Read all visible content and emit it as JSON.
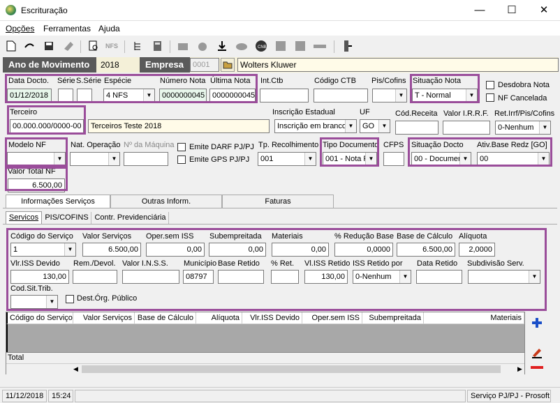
{
  "window": {
    "title": "Escrituração",
    "min": "—",
    "max": "☐",
    "close": "✕"
  },
  "menu": [
    "Opções",
    "Ferramentas",
    "Ajuda"
  ],
  "header": {
    "ano_label": "Ano de Movimento",
    "ano_value": "2018",
    "empresa_label": "Empresa",
    "empresa_code": "0001",
    "empresa_name": "Wolters Kluwer"
  },
  "fields": {
    "data_docto": {
      "label": "Data Docto.",
      "value": "01/12/2018"
    },
    "serie": {
      "label": "Série",
      "value": ""
    },
    "sserie": {
      "label": "S.Série",
      "value": ""
    },
    "especie": {
      "label": "Espécie",
      "value": "4 NFS"
    },
    "numero_nota": {
      "label": "Número Nota",
      "value": "0000000045"
    },
    "ultima_nota": {
      "label": "Última Nota",
      "value": "0000000045"
    },
    "int_ctb": {
      "label": "Int.Ctb",
      "value": ""
    },
    "codigo_ctb": {
      "label": "Código CTB",
      "value": ""
    },
    "pis_cofins": {
      "label": "Pis/Cofins",
      "value": ""
    },
    "situacao_nota": {
      "label": "Situação Nota",
      "value": "T - Normal"
    },
    "desdobra_nota": {
      "label": "Desdobra Nota"
    },
    "nf_cancelada": {
      "label": "NF Cancelada"
    },
    "terceiro": {
      "label": "Terceiro",
      "code": "00.000.000/0000-00",
      "name": "Terceiros Teste 2018"
    },
    "inscricao_estadual": {
      "label": "Inscrição Estadual",
      "value": "Inscrição em branco"
    },
    "uf": {
      "label": "UF",
      "value": "GO"
    },
    "cod_receita": {
      "label": "Cód.Receita",
      "value": ""
    },
    "valor_irrf": {
      "label": "Valor I.R.R.F.",
      "value": ""
    },
    "ret_irrf": {
      "label": "Ret.Irrf/Pis/Cofins",
      "value": "0-Nenhum"
    },
    "modelo_nf": {
      "label": "Modelo NF",
      "value": ""
    },
    "nat_operacao": {
      "label": "Nat. Operação",
      "value": ""
    },
    "num_maquina": {
      "label": "Nº da Máquina",
      "value": ""
    },
    "emite_darf": {
      "label": "Emite DARF PJ/PJ"
    },
    "emite_gps": {
      "label": "Emite GPS PJ/PJ"
    },
    "tp_recolhimento": {
      "label": "Tp. Recolhimento",
      "value": "001"
    },
    "tipo_documento": {
      "label": "Tipo Documento",
      "value": "001 - Nota F"
    },
    "cfps": {
      "label": "CFPS",
      "value": ""
    },
    "situacao_docto": {
      "label": "Situação Docto",
      "value": "00 - Documen"
    },
    "ativ_base": {
      "label": "Ativ.Base Redz [GO]",
      "value": "00"
    },
    "valor_total_nf": {
      "label": "Valor Total NF",
      "value": "6.500,00"
    }
  },
  "tabs_main": [
    "Informações Serviços",
    "Outras Inform.",
    "Faturas"
  ],
  "tabs_sub": [
    "Servicos",
    "PIS/COFINS",
    "Contr. Previdenciária"
  ],
  "servicos": {
    "codigo_servico": {
      "label": "Código do Serviço",
      "value": "1"
    },
    "valor_servicos": {
      "label": "Valor Serviços",
      "value": "6.500,00"
    },
    "oper_sem_iss": {
      "label": "Oper.sem ISS",
      "value": "0,00"
    },
    "subempreitada": {
      "label": "Subempreitada",
      "value": "0,00"
    },
    "materiais": {
      "label": "Materiais",
      "value": "0,00"
    },
    "reducao_base": {
      "label": "% Redução Base",
      "value": "0,0000"
    },
    "base_calculo": {
      "label": "Base de Cálculo",
      "value": "6.500,00"
    },
    "aliquota": {
      "label": "Alíquota",
      "value": "2,0000"
    },
    "vlr_iss_devido": {
      "label": "Vlr.ISS Devido",
      "value": "130,00"
    },
    "rem_devol": {
      "label": "Rem./Devol.",
      "value": ""
    },
    "valor_inss": {
      "label": "Valor I.N.S.S.",
      "value": ""
    },
    "municipio": {
      "label": "Município",
      "value": "08797"
    },
    "base_retido": {
      "label": "Base Retido",
      "value": ""
    },
    "pct_ret": {
      "label": "% Ret.",
      "value": ""
    },
    "vl_iss_retido": {
      "label": "Vl.ISS Retido",
      "value": "130,00"
    },
    "iss_retido_por": {
      "label": "ISS Retido por",
      "value": "0-Nenhum"
    },
    "data_retido": {
      "label": "Data Retido",
      "value": ""
    },
    "subdivisao": {
      "label": "Subdivisão Serv.",
      "value": ""
    },
    "cod_sit_trib": {
      "label": "Cod.Sit.Trib.",
      "value": ""
    },
    "dest_org": {
      "label": "Dest.Órg. Público"
    }
  },
  "grid": {
    "columns": [
      "Código do Serviço",
      "Valor Serviços",
      "Base de Cálculo",
      "Alíquota",
      "Vlr.ISS Devido",
      "Oper.sem ISS",
      "Subempreitada",
      "Materiais"
    ],
    "total_label": "Total"
  },
  "status": {
    "date": "11/12/2018",
    "time": "15:24",
    "system": "Serviço PJ/PJ - Prosoft"
  },
  "colors": {
    "highlight": "#9a4d9a",
    "header_bg": "#5a5a5a",
    "green_field": "#e8f7ec"
  },
  "icons": [
    "new-icon",
    "undo-icon",
    "save-icon",
    "eraser-icon",
    "print-preview-icon",
    "nfs-icon",
    "tree-icon",
    "calc-icon",
    "folder-icon",
    "chart-icon",
    "download-icon",
    "cloud-icon",
    "cnb-icon",
    "list-icon",
    "square-icon",
    "minus-icon",
    "exit-icon",
    "plus-icon",
    "edit-icon",
    "remove-icon"
  ]
}
